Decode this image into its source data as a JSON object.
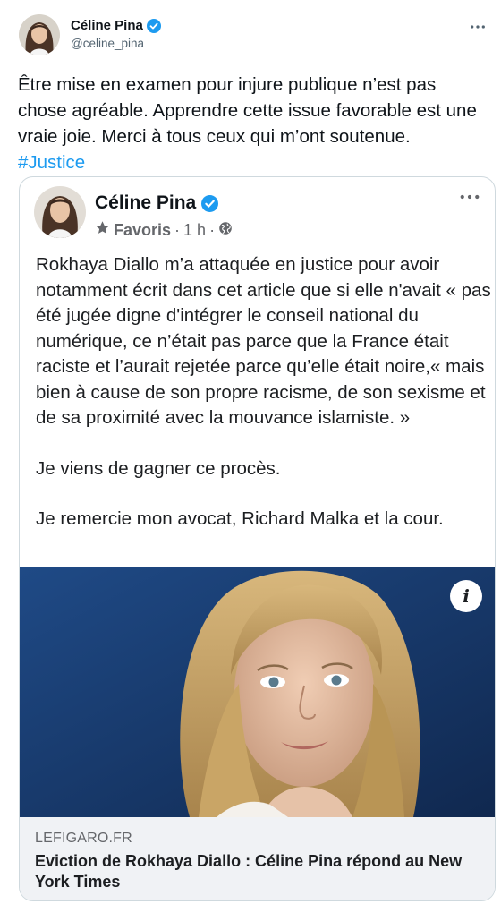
{
  "tweet": {
    "author": {
      "name": "Céline Pina",
      "handle": "@celine_pina"
    },
    "text": "Être mise en examen pour injure publique n’est pas chose agréable. Apprendre cette issue favorable est une vraie joie. Merci à tous ceux qui m’ont soutenue.",
    "hashtag": "#Justice"
  },
  "quoted_post": {
    "author_name": "Céline Pina",
    "meta": {
      "favorites_label": "Favoris",
      "separator": "·",
      "time": "1 h",
      "separator2": "·"
    },
    "paragraphs": [
      "Rokhaya Diallo m’a attaquée en justice pour avoir notamment écrit dans cet article que si elle n'avait «  pas été jugée digne d'intégrer le conseil national du numérique, ce n’était pas parce que la France était raciste et l’aurait rejetée parce qu’elle était noire,« mais bien à cause de son propre racisme, de son sexisme et de sa proximité avec la mouvance islamiste. »",
      "Je viens de gagner ce procès.",
      "Je remercie mon avocat, Richard Malka et la cour."
    ],
    "link": {
      "domain": "LEFIGARO.FR",
      "title": "Eviction de Rokhaya Diallo : Céline Pina répond au New York Times"
    },
    "info_glyph": "i"
  },
  "icons": {
    "verified": "verified-badge-icon",
    "more": "more-dots-icon",
    "star": "star-icon",
    "globe": "globe-icon",
    "info": "info-icon"
  },
  "colors": {
    "link_blue": "#1d9bf0",
    "verified_blue": "#1d9bf0",
    "text": "#0f1419",
    "secondary": "#536471",
    "card_bg": "#f0f2f5"
  }
}
